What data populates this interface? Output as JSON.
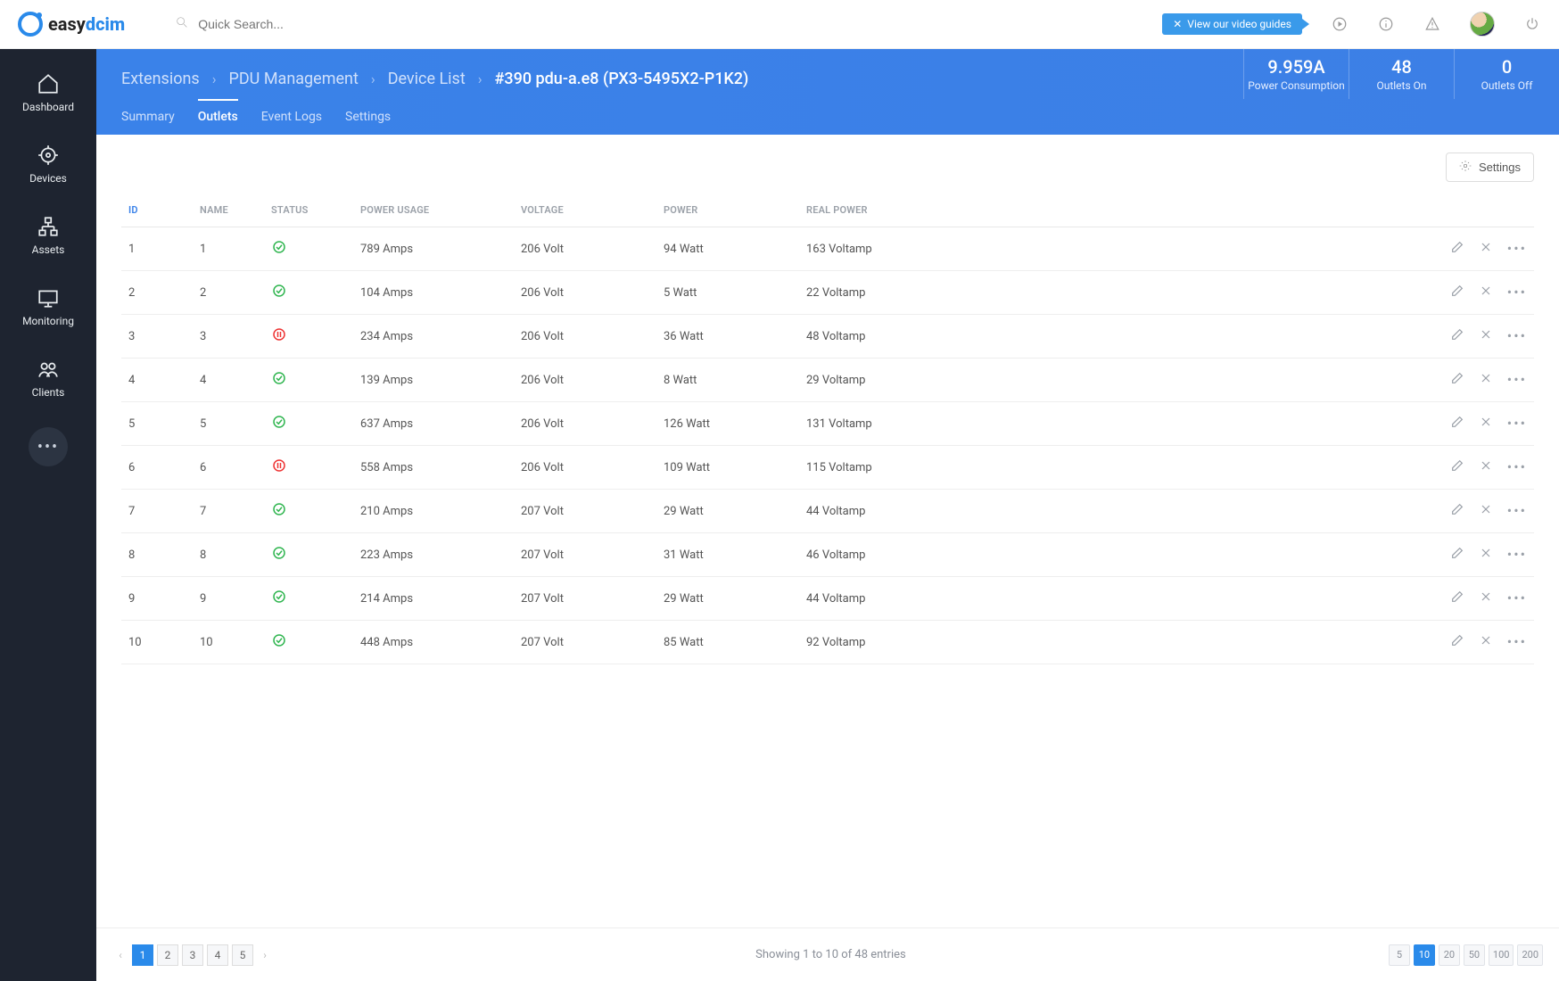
{
  "brand": {
    "name_prefix": "easy",
    "name_suffix": "dcim"
  },
  "search": {
    "placeholder": "Quick Search..."
  },
  "banner": {
    "label": "View our video guides"
  },
  "sidebar": {
    "items": [
      {
        "label": "Dashboard"
      },
      {
        "label": "Devices"
      },
      {
        "label": "Assets"
      },
      {
        "label": "Monitoring"
      },
      {
        "label": "Clients"
      }
    ]
  },
  "breadcrumbs": [
    {
      "label": "Extensions"
    },
    {
      "label": "PDU Management"
    },
    {
      "label": "Device List"
    },
    {
      "label": "#390 pdu-a.e8 (PX3-5495X2-P1K2)",
      "current": true
    }
  ],
  "stats": [
    {
      "value": "9.959A",
      "label": "Power Consumption"
    },
    {
      "value": "48",
      "label": "Outlets On"
    },
    {
      "value": "0",
      "label": "Outlets Off"
    }
  ],
  "tabs": [
    {
      "label": "Summary"
    },
    {
      "label": "Outlets",
      "active": true
    },
    {
      "label": "Event Logs"
    },
    {
      "label": "Settings"
    }
  ],
  "settings_button": "Settings",
  "table": {
    "headers": [
      "ID",
      "NAME",
      "STATUS",
      "POWER USAGE",
      "VOLTAGE",
      "POWER",
      "REAL POWER"
    ],
    "rows": [
      {
        "id": "1",
        "name": "1",
        "status": "on",
        "power_usage": "789 Amps",
        "voltage": "206 Volt",
        "power": "94 Watt",
        "real_power": "163 Voltamp"
      },
      {
        "id": "2",
        "name": "2",
        "status": "on",
        "power_usage": "104 Amps",
        "voltage": "206 Volt",
        "power": "5 Watt",
        "real_power": "22 Voltamp"
      },
      {
        "id": "3",
        "name": "3",
        "status": "off",
        "power_usage": "234 Amps",
        "voltage": "206 Volt",
        "power": "36 Watt",
        "real_power": "48 Voltamp"
      },
      {
        "id": "4",
        "name": "4",
        "status": "on",
        "power_usage": "139 Amps",
        "voltage": "206 Volt",
        "power": "8 Watt",
        "real_power": "29 Voltamp"
      },
      {
        "id": "5",
        "name": "5",
        "status": "on",
        "power_usage": "637 Amps",
        "voltage": "206 Volt",
        "power": "126 Watt",
        "real_power": "131 Voltamp"
      },
      {
        "id": "6",
        "name": "6",
        "status": "off",
        "power_usage": "558 Amps",
        "voltage": "206 Volt",
        "power": "109 Watt",
        "real_power": "115 Voltamp"
      },
      {
        "id": "7",
        "name": "7",
        "status": "on",
        "power_usage": "210 Amps",
        "voltage": "207 Volt",
        "power": "29 Watt",
        "real_power": "44 Voltamp"
      },
      {
        "id": "8",
        "name": "8",
        "status": "on",
        "power_usage": "223 Amps",
        "voltage": "207 Volt",
        "power": "31 Watt",
        "real_power": "46 Voltamp"
      },
      {
        "id": "9",
        "name": "9",
        "status": "on",
        "power_usage": "214 Amps",
        "voltage": "207 Volt",
        "power": "29 Watt",
        "real_power": "44 Voltamp"
      },
      {
        "id": "10",
        "name": "10",
        "status": "on",
        "power_usage": "448 Amps",
        "voltage": "207 Volt",
        "power": "85 Watt",
        "real_power": "92 Voltamp"
      }
    ]
  },
  "pagination": {
    "pages": [
      "1",
      "2",
      "3",
      "4",
      "5"
    ],
    "active_page": "1",
    "summary": "Showing 1 to 10 of 48 entries",
    "sizes": [
      "5",
      "10",
      "20",
      "50",
      "100",
      "200"
    ],
    "active_size": "10"
  }
}
